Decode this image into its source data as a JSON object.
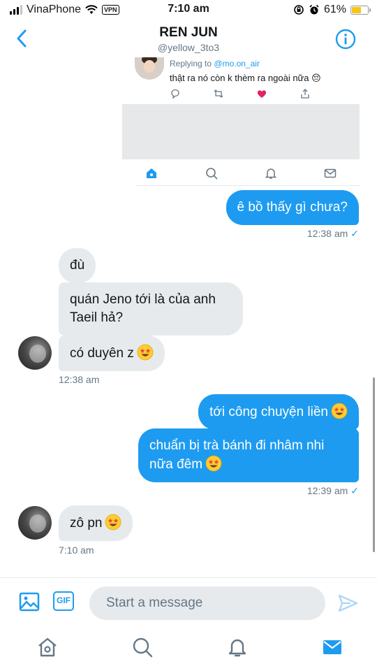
{
  "status_bar": {
    "carrier": "VinaPhone",
    "vpn": "VPN",
    "time": "7:10 am",
    "battery": "61%",
    "battery_level": 0.61
  },
  "header": {
    "title": "REN JUN",
    "handle": "@yellow_3to3"
  },
  "embedded_tweet": {
    "replying_prefix": "Replying to",
    "replying_handle": "@mo.on_air",
    "text": "thật ra nó còn k thèm ra ngoài nữa 😔"
  },
  "messages": [
    {
      "side": "sent",
      "text": "ê bồ thấy gì chưa?"
    },
    {
      "side": "sent_meta",
      "text": "12:38 am"
    },
    {
      "side": "received",
      "text": "đù"
    },
    {
      "side": "received",
      "text": "quán Jeno tới là của anh Taeil hả?"
    },
    {
      "side": "received",
      "text": "có duyên z"
    },
    {
      "side": "received_meta",
      "text": "12:38 am"
    },
    {
      "side": "sent",
      "text": "tới công chuyện liền"
    },
    {
      "side": "sent",
      "text": "chuẩn bị trà bánh đi nhâm nhi nữa đêm"
    },
    {
      "side": "sent_meta",
      "text": "12:39 am"
    },
    {
      "side": "received",
      "text": "zô pn"
    },
    {
      "side": "received_meta",
      "text": "7:10 am"
    }
  ],
  "composer": {
    "gif_label": "GIF",
    "placeholder": "Start a message"
  },
  "colors": {
    "accent": "#1d9bf0",
    "received_bubble": "#e7eaed",
    "meta_text": "#657786"
  },
  "icons": {
    "back": "chevron-left-icon",
    "info": "info-icon",
    "image": "image-icon",
    "send": "send-icon",
    "nav": [
      "home-icon",
      "search-icon",
      "bell-icon",
      "mail-icon"
    ],
    "emoji": "star-struck-emoji"
  }
}
